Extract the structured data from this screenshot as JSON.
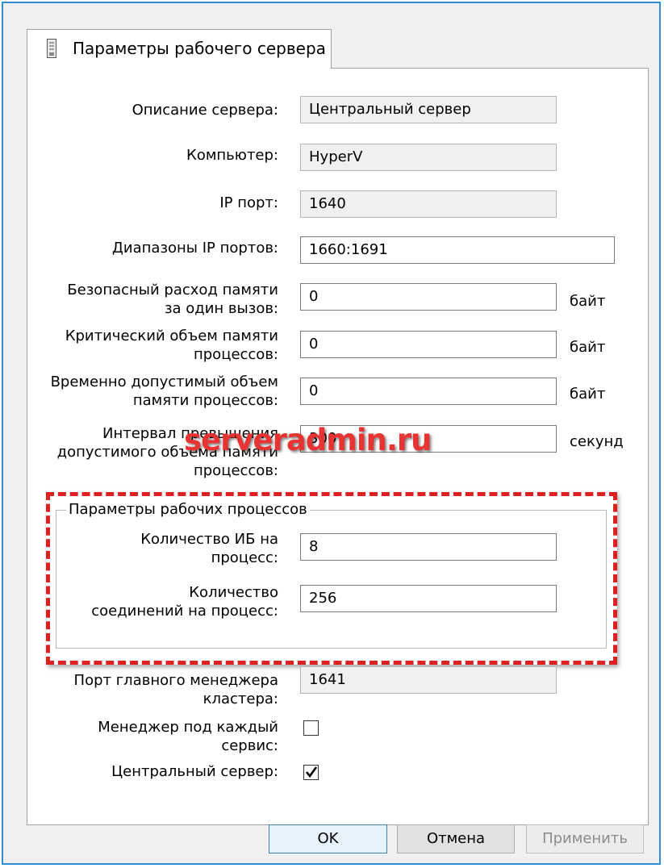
{
  "tab": {
    "label": "Параметры рабочего сервера"
  },
  "fields": {
    "description": {
      "label": "Описание сервера:",
      "value": "Центральный сервер"
    },
    "computer": {
      "label": "Компьютер:",
      "value": "HyperV"
    },
    "ip_port": {
      "label": "IP порт:",
      "value": "1640"
    },
    "port_ranges": {
      "label": "Диапазоны IP портов:",
      "value": "1660:1691"
    },
    "safe_memory": {
      "label_line1": "Безопасный расход памяти",
      "label_line2": "за один вызов:",
      "value": "0",
      "unit": "байт"
    },
    "critical_memory": {
      "label_line1": "Критический объем памяти",
      "label_line2": "процессов:",
      "value": "0",
      "unit": "байт"
    },
    "temp_memory": {
      "label_line1": "Временно допустимый объем",
      "label_line2": "памяти процессов:",
      "value": "0",
      "unit": "байт"
    },
    "interval": {
      "label_line1": "Интервал превышения",
      "label_line2": "допустимого объема памяти",
      "label_line3": "процессов:",
      "value": "300",
      "unit": "секунд"
    }
  },
  "group": {
    "title": "Параметры рабочих процессов",
    "ib_per_process": {
      "label_line1": "Количество ИБ на",
      "label_line2": "процесс:",
      "value": "8"
    },
    "connections_per_process": {
      "label_line1": "Количество",
      "label_line2": "соединений на процесс:",
      "value": "256"
    }
  },
  "cluster_manager_port": {
    "label_line1": "Порт главного менеджера",
    "label_line2": "кластера:",
    "value": "1641"
  },
  "manager_per_service": {
    "label_line1": "Менеджер под каждый",
    "label_line2": "сервис:",
    "checked": false
  },
  "central_server": {
    "label": "Центральный сервер:",
    "checked": true
  },
  "watermark": "serveradmin.ru",
  "buttons": {
    "ok": "OK",
    "cancel": "Отмена",
    "apply": "Применить"
  },
  "colors": {
    "highlight_border": "#e02020",
    "window_border": "#2f8fd6",
    "watermark": "#e83333"
  },
  "icons": {
    "tab": "server-icon",
    "checkmark": "checkmark-icon"
  }
}
